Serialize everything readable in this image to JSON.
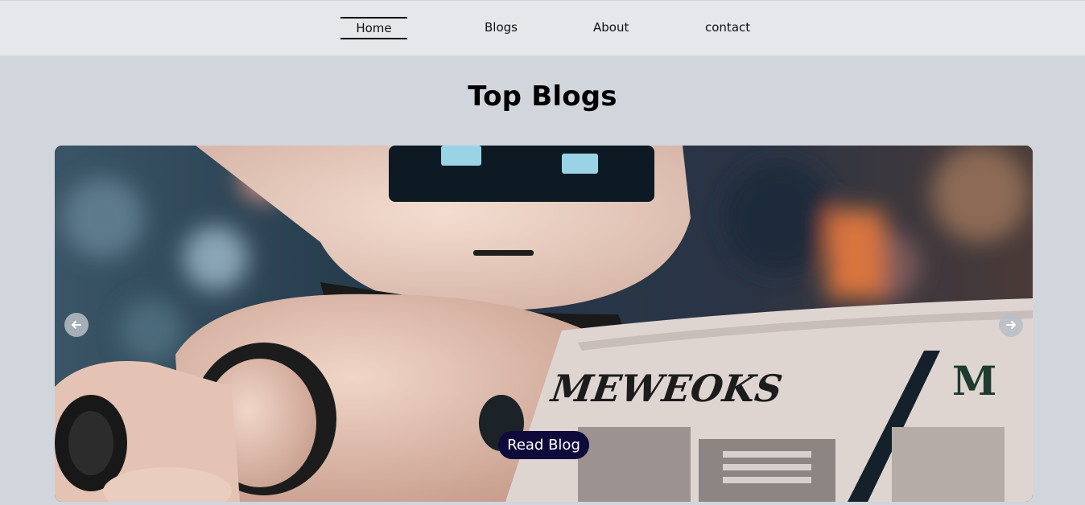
{
  "nav": {
    "items": [
      {
        "label": "Home",
        "active": true
      },
      {
        "label": "Blogs",
        "active": false
      },
      {
        "label": "About",
        "active": false
      },
      {
        "label": "contact",
        "active": false
      }
    ]
  },
  "main": {
    "title": "Top Blogs"
  },
  "carousel": {
    "image_alt_text_visible": "",
    "newspaper_masthead": "MEWEOKS",
    "read_button_label": "Read Blog",
    "prev_icon": "arrow-left-icon",
    "next_icon": "arrow-right-icon"
  },
  "colors": {
    "page_bg": "#d1d5dc",
    "nav_bg": "#e5e7eb",
    "button_bg": "#0f0a3c",
    "button_text": "#ffffff"
  }
}
